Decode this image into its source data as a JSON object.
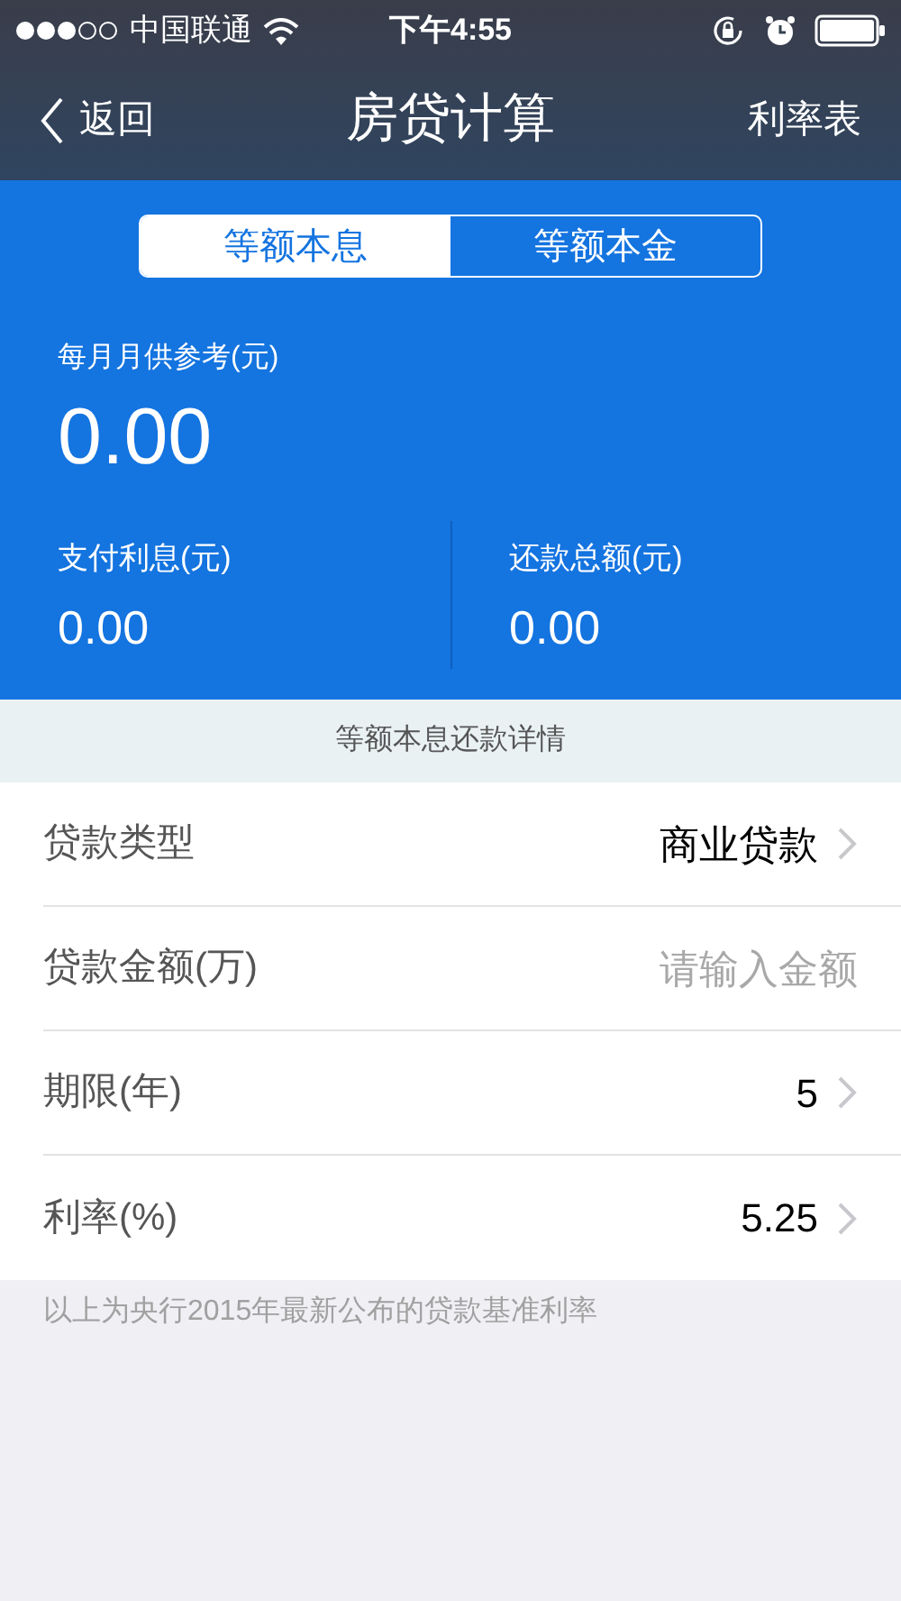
{
  "status_bar": {
    "carrier": "中国联通",
    "time": "下午4:55"
  },
  "nav": {
    "back": "返回",
    "title": "房贷计算",
    "action": "利率表"
  },
  "tabs": [
    {
      "label": "等额本息",
      "selected": true
    },
    {
      "label": "等额本金",
      "selected": false
    }
  ],
  "summary": {
    "monthly_label": "每月月供参考(元)",
    "monthly_value": "0.00",
    "stats": [
      {
        "label": "支付利息(元)",
        "value": "0.00"
      },
      {
        "label": "还款总额(元)",
        "value": "0.00"
      }
    ]
  },
  "detail_header": "等额本息还款详情",
  "form": [
    {
      "kind": "select",
      "label": "贷款类型",
      "value": "商业贷款"
    },
    {
      "kind": "input",
      "label": "贷款金额(万)",
      "placeholder": "请输入金额"
    },
    {
      "kind": "select",
      "label": "期限(年)",
      "value": "5"
    },
    {
      "kind": "select",
      "label": "利率(%)",
      "value": "5.25"
    }
  ],
  "footnote": "以上为央行2015年最新公布的贷款基准利率"
}
